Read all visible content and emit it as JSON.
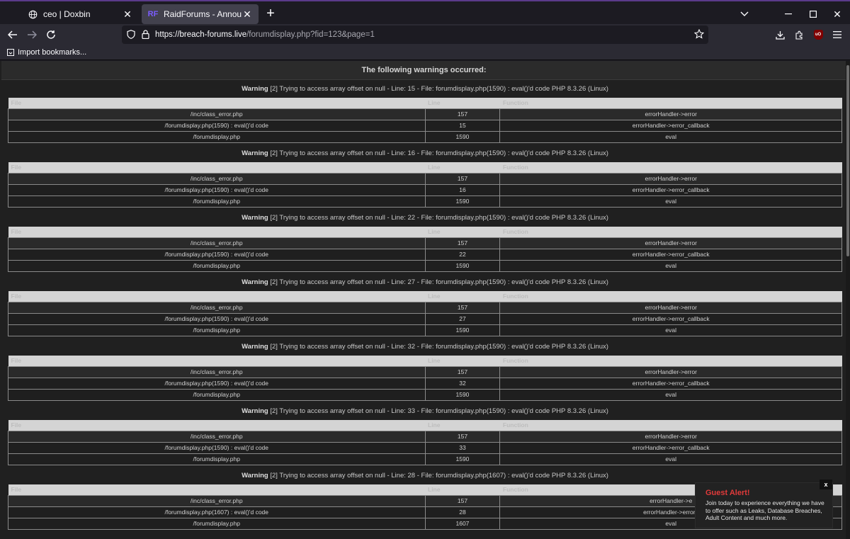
{
  "browser": {
    "tabs": [
      {
        "label": "ceo | Doxbin",
        "icon": "globe-icon"
      },
      {
        "label": "RaidForums - Announcements",
        "icon": "rf-favicon",
        "favicon_text": "RF"
      }
    ],
    "url_host": "https://breach-forums.live",
    "url_path": "/forumdisplay.php?fid=123&page=1",
    "bookmark": "Import bookmarks...",
    "ext_badge": "uO"
  },
  "page": {
    "header": "The following warnings occurred:",
    "columns": [
      "File",
      "Line",
      "Function"
    ],
    "warnings": [
      {
        "label": "Warning",
        "text": " [2] Trying to access array offset on null - Line: 15 - File: forumdisplay.php(1590) : eval()'d code PHP 8.3.26 (Linux)",
        "rows": [
          [
            "/inc/class_error.php",
            "157",
            "errorHandler->error"
          ],
          [
            "/forumdisplay.php(1590) : eval()'d code",
            "15",
            "errorHandler->error_callback"
          ],
          [
            "/forumdisplay.php",
            "1590",
            "eval"
          ]
        ]
      },
      {
        "label": "Warning",
        "text": " [2] Trying to access array offset on null - Line: 16 - File: forumdisplay.php(1590) : eval()'d code PHP 8.3.26 (Linux)",
        "rows": [
          [
            "/inc/class_error.php",
            "157",
            "errorHandler->error"
          ],
          [
            "/forumdisplay.php(1590) : eval()'d code",
            "16",
            "errorHandler->error_callback"
          ],
          [
            "/forumdisplay.php",
            "1590",
            "eval"
          ]
        ]
      },
      {
        "label": "Warning",
        "text": " [2] Trying to access array offset on null - Line: 22 - File: forumdisplay.php(1590) : eval()'d code PHP 8.3.26 (Linux)",
        "rows": [
          [
            "/inc/class_error.php",
            "157",
            "errorHandler->error"
          ],
          [
            "/forumdisplay.php(1590) : eval()'d code",
            "22",
            "errorHandler->error_callback"
          ],
          [
            "/forumdisplay.php",
            "1590",
            "eval"
          ]
        ]
      },
      {
        "label": "Warning",
        "text": " [2] Trying to access array offset on null - Line: 27 - File: forumdisplay.php(1590) : eval()'d code PHP 8.3.26 (Linux)",
        "rows": [
          [
            "/inc/class_error.php",
            "157",
            "errorHandler->error"
          ],
          [
            "/forumdisplay.php(1590) : eval()'d code",
            "27",
            "errorHandler->error_callback"
          ],
          [
            "/forumdisplay.php",
            "1590",
            "eval"
          ]
        ]
      },
      {
        "label": "Warning",
        "text": " [2] Trying to access array offset on null - Line: 32 - File: forumdisplay.php(1590) : eval()'d code PHP 8.3.26 (Linux)",
        "rows": [
          [
            "/inc/class_error.php",
            "157",
            "errorHandler->error"
          ],
          [
            "/forumdisplay.php(1590) : eval()'d code",
            "32",
            "errorHandler->error_callback"
          ],
          [
            "/forumdisplay.php",
            "1590",
            "eval"
          ]
        ]
      },
      {
        "label": "Warning",
        "text": " [2] Trying to access array offset on null - Line: 33 - File: forumdisplay.php(1590) : eval()'d code PHP 8.3.26 (Linux)",
        "rows": [
          [
            "/inc/class_error.php",
            "157",
            "errorHandler->error"
          ],
          [
            "/forumdisplay.php(1590) : eval()'d code",
            "33",
            "errorHandler->error_callback"
          ],
          [
            "/forumdisplay.php",
            "1590",
            "eval"
          ]
        ]
      },
      {
        "label": "Warning",
        "text": " [2] Trying to access array offset on null - Line: 28 - File: forumdisplay.php(1607) : eval()'d code PHP 8.3.26 (Linux)",
        "rows": [
          [
            "/inc/class_error.php",
            "157",
            "errorHandler->e"
          ],
          [
            "/forumdisplay.php(1607) : eval()'d code",
            "28",
            "errorHandler->error_"
          ],
          [
            "/forumdisplay.php",
            "1607",
            "eval"
          ]
        ]
      }
    ]
  },
  "guest_alert": {
    "title": "Guest Alert!",
    "text": "Join today to experience everything we have to offer such as Leaks, Database Breaches, Adult Content and much more.",
    "close": "x"
  },
  "colors": {
    "alert_title": "#e03a3a",
    "tab_active": "#42414d",
    "window_border": "#5b3a8a"
  }
}
